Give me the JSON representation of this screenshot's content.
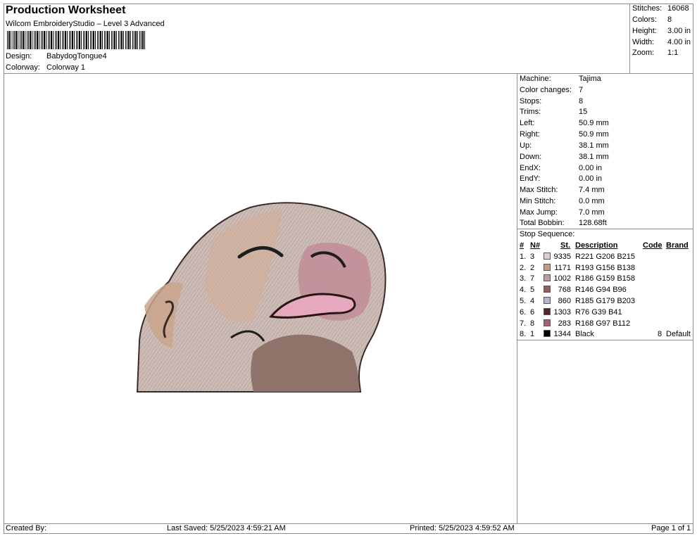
{
  "header": {
    "title": "Production Worksheet",
    "software": "Wilcom EmbroideryStudio – Level 3 Advanced",
    "design_label": "Design:",
    "design_value": "BabydogTongue4",
    "colorway_label": "Colorway:",
    "colorway_value": "Colorway 1"
  },
  "summary": [
    {
      "label": "Stitches:",
      "value": "16068"
    },
    {
      "label": "Colors:",
      "value": "8"
    },
    {
      "label": "Height:",
      "value": "3.00 in"
    },
    {
      "label": "Width:",
      "value": "4.00 in"
    },
    {
      "label": "Zoom:",
      "value": "1:1"
    }
  ],
  "machine_info": [
    {
      "label": "Machine:",
      "value": "Tajima"
    },
    {
      "label": "Color changes:",
      "value": "7"
    },
    {
      "label": "Stops:",
      "value": "8"
    },
    {
      "label": "Trims:",
      "value": "15"
    },
    {
      "label": "Left:",
      "value": "50.9 mm"
    },
    {
      "label": "Right:",
      "value": "50.9 mm"
    },
    {
      "label": "Up:",
      "value": "38.1 mm"
    },
    {
      "label": "Down:",
      "value": "38.1 mm"
    },
    {
      "label": "EndX:",
      "value": "0.00 in"
    },
    {
      "label": "EndY:",
      "value": "0.00 in"
    },
    {
      "label": "Max Stitch:",
      "value": "7.4 mm"
    },
    {
      "label": "Min Stitch:",
      "value": "0.0 mm"
    },
    {
      "label": "Max Jump:",
      "value": "7.0 mm"
    },
    {
      "label": "Total Bobbin:",
      "value": "128.68ft"
    }
  ],
  "stop_sequence": {
    "title": "Stop Sequence:",
    "columns": {
      "num": "#",
      "needle": "N#",
      "st": "St.",
      "desc": "Description",
      "code": "Code",
      "brand": "Brand"
    },
    "rows": [
      {
        "num": "1.",
        "needle": "3",
        "color": "#DDCED7",
        "st": "9335",
        "desc": "R221 G206 B215",
        "code": "",
        "brand": ""
      },
      {
        "num": "2.",
        "needle": "2",
        "color": "#C19C8A",
        "st": "1171",
        "desc": "R193 G156 B138",
        "code": "",
        "brand": ""
      },
      {
        "num": "3.",
        "needle": "7",
        "color": "#BA9F9E",
        "st": "1002",
        "desc": "R186 G159 B158",
        "code": "",
        "brand": ""
      },
      {
        "num": "4.",
        "needle": "5",
        "color": "#925E60",
        "st": "768",
        "desc": "R146 G94 B96",
        "code": "",
        "brand": ""
      },
      {
        "num": "5.",
        "needle": "4",
        "color": "#B9B3CB",
        "st": "860",
        "desc": "R185 G179 B203",
        "code": "",
        "brand": ""
      },
      {
        "num": "6.",
        "needle": "6",
        "color": "#4C2729",
        "st": "1303",
        "desc": "R76 G39 B41",
        "code": "",
        "brand": ""
      },
      {
        "num": "7.",
        "needle": "8",
        "color": "#A86170",
        "st": "283",
        "desc": "R168 G97 B112",
        "code": "",
        "brand": ""
      },
      {
        "num": "8.",
        "needle": "1",
        "color": "#000000",
        "st": "1344",
        "desc": "Black",
        "code": "8",
        "brand": "Default"
      }
    ]
  },
  "footer": {
    "created_by": "Created By:",
    "last_saved": "Last Saved: 5/25/2023 4:59:21 AM",
    "printed": "Printed: 5/25/2023 4:59:52 AM",
    "page": "Page 1 of 1"
  }
}
